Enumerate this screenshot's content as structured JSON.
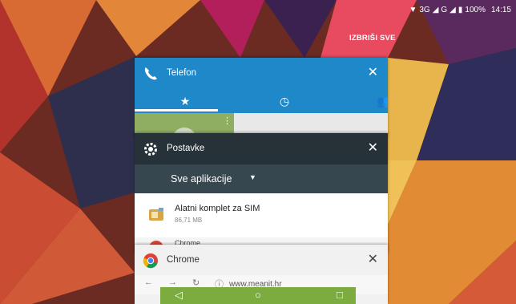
{
  "statusbar": {
    "network_3g": "3G",
    "network_g": "G",
    "battery": "100%",
    "time": "14:15"
  },
  "recents": {
    "clear_all": "IZBRIŠI SVE"
  },
  "cards": {
    "telefon": {
      "title": "Telefon",
      "tabs": [
        "star-icon",
        "clock-icon",
        "people-icon"
      ]
    },
    "postavke": {
      "title": "Postavke",
      "filter": "Sve aplikacije",
      "app_item": {
        "name": "Alatni komplet za SIM",
        "size": "86,71 MB"
      },
      "next_item": "Chrome"
    },
    "chrome": {
      "title": "Chrome",
      "url": "www.meanit.hr"
    }
  },
  "colors": {
    "telefon_header": "#1e88c8",
    "postavke_header": "#263238",
    "postavke_filter": "#37474f",
    "navbar": "#7cab3f"
  }
}
